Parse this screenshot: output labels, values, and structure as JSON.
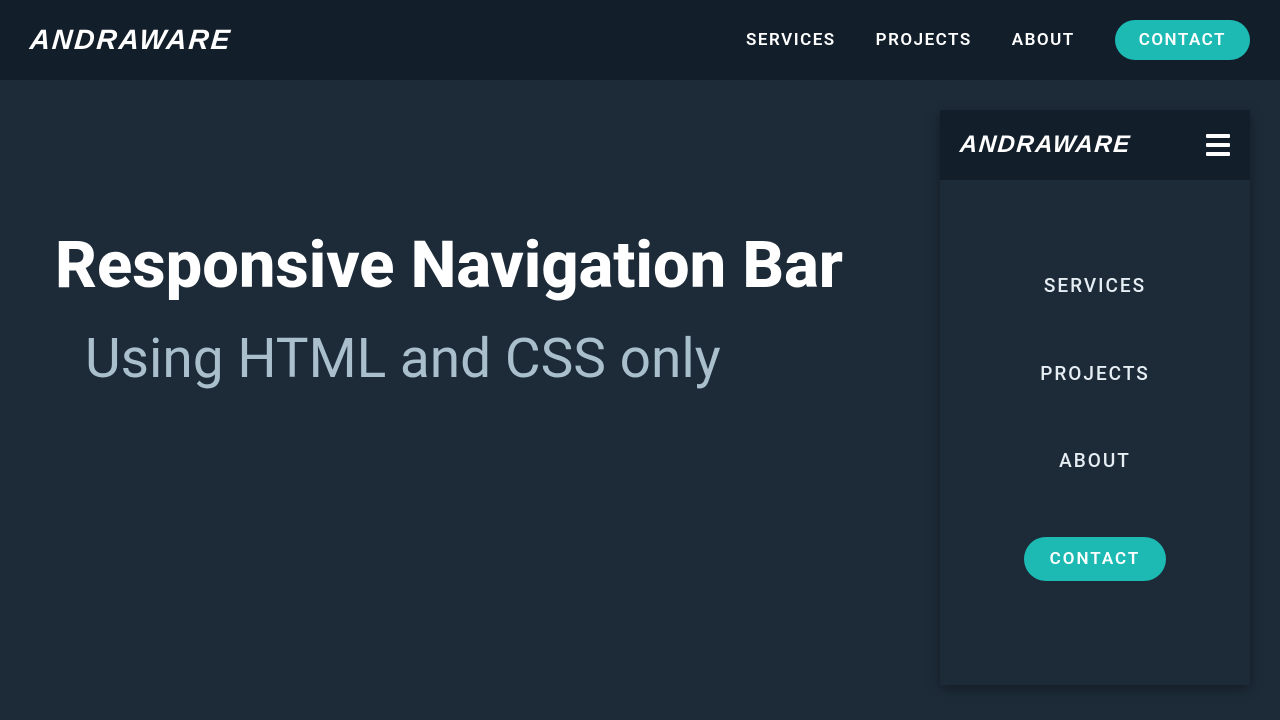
{
  "navbar": {
    "logo": "ANDRAWARE",
    "links": {
      "services": "SERVICES",
      "projects": "PROJECTS",
      "about": "ABOUT",
      "contact": "CONTACT"
    }
  },
  "hero": {
    "title": "Responsive Navigation Bar",
    "subtitle": "Using HTML and CSS only"
  },
  "mobile": {
    "logo": "ANDRAWARE",
    "links": {
      "services": "SERVICES",
      "projects": "PROJECTS",
      "about": "ABOUT",
      "contact": "CONTACT"
    }
  },
  "colors": {
    "accent": "#1dbab4",
    "navbar_bg": "#121e29",
    "page_bg": "#1d2b39"
  }
}
